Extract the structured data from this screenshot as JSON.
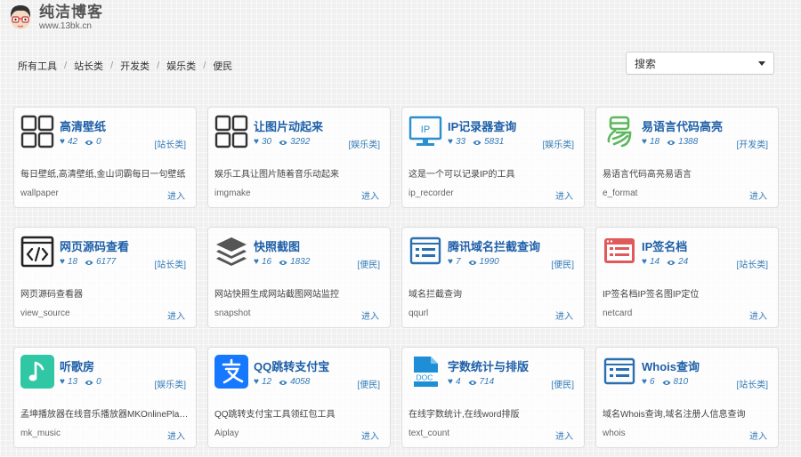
{
  "brand": {
    "name": "纯洁博客",
    "url": "www.13bk.cn"
  },
  "breadcrumb": [
    "所有工具",
    "站长类",
    "开发类",
    "娱乐类",
    "便民"
  ],
  "search": {
    "label": "搜索"
  },
  "colors": {
    "link": "#337ab7",
    "title": "#1e5fa8"
  },
  "tools": [
    {
      "icon": "grid-icon",
      "title": "高清壁纸",
      "likes": "42",
      "views": "0",
      "category": "[站长类]",
      "desc": "每日壁纸,高清壁纸,金山词霸每日一句壁纸",
      "slug": "wallpaper",
      "action": "进入"
    },
    {
      "icon": "grid-icon",
      "title": "让图片动起来",
      "likes": "30",
      "views": "3292",
      "category": "[娱乐类]",
      "desc": "娱乐工具让图片随着音乐动起来",
      "slug": "imgmake",
      "action": "进入"
    },
    {
      "icon": "ip-monitor-icon",
      "title": "IP记录器查询",
      "likes": "33",
      "views": "5831",
      "category": "[娱乐类]",
      "desc": "这是一个可以记录IP的工具",
      "slug": "ip_recorder",
      "action": "进入"
    },
    {
      "icon": "easy-lang-icon",
      "title": "易语言代码高亮",
      "likes": "18",
      "views": "1388",
      "category": "[开发类]",
      "desc": "易语言代码高亮易语言",
      "slug": "e_format",
      "action": "进入"
    },
    {
      "icon": "code-icon",
      "title": "网页源码查看",
      "likes": "18",
      "views": "6177",
      "category": "[站长类]",
      "desc": "网页源码查看器",
      "slug": "view_source",
      "action": "进入"
    },
    {
      "icon": "layers-icon",
      "title": "快照截图",
      "likes": "16",
      "views": "1832",
      "category": "[便民]",
      "desc": "网站快照生成网站截图网站监控",
      "slug": "snapshot",
      "action": "进入"
    },
    {
      "icon": "domain-list-icon",
      "title": "腾讯域名拦截查询",
      "likes": "7",
      "views": "1990",
      "category": "[便民]",
      "desc": "域名拦截查询",
      "slug": "qqurl",
      "action": "进入"
    },
    {
      "icon": "ip-card-icon",
      "title": "IP签名档",
      "likes": "14",
      "views": "24",
      "category": "[站长类]",
      "desc": "IP签名档IP签名图IP定位",
      "slug": "netcard",
      "action": "进入"
    },
    {
      "icon": "music-icon",
      "title": "听歌房",
      "likes": "13",
      "views": "0",
      "category": "[娱乐类]",
      "desc": "孟坤播放器在线音乐播放器MKOnlinePlayer",
      "slug": "mk_music",
      "action": "进入"
    },
    {
      "icon": "alipay-icon",
      "title": "QQ跳转支付宝",
      "likes": "12",
      "views": "4058",
      "category": "[便民]",
      "desc": "QQ跳转支付宝工具领红包工具",
      "slug": "Aiplay",
      "action": "进入"
    },
    {
      "icon": "doc-icon",
      "title": "字数统计与排版",
      "likes": "4",
      "views": "714",
      "category": "[便民]",
      "desc": "在线字数统计,在线word排版",
      "slug": "text_count",
      "action": "进入"
    },
    {
      "icon": "whois-icon",
      "title": "Whois查询",
      "likes": "6",
      "views": "810",
      "category": "[站长类]",
      "desc": "域名Whois查询,域名注册人信息查询",
      "slug": "whois",
      "action": "进入"
    }
  ]
}
